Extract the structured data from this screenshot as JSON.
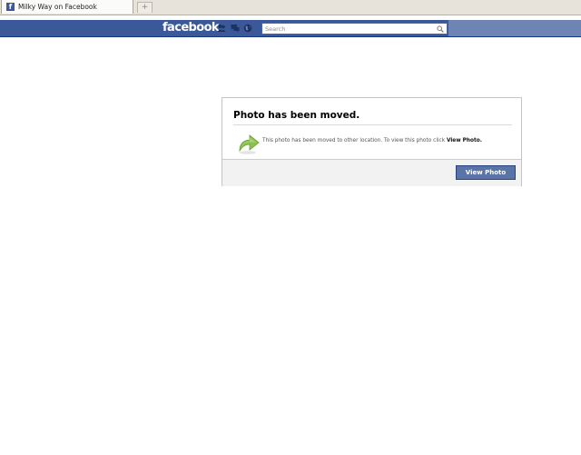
{
  "browser": {
    "tab_title": "Milky Way on Facebook",
    "tab_favicon": "f",
    "new_tab_label": "+"
  },
  "header": {
    "logo": "facebook",
    "jewel_icons": [
      "friend-requests-icon",
      "messages-icon",
      "notifications-globe-icon"
    ],
    "search": {
      "placeholder": "Search",
      "value": ""
    }
  },
  "dialog": {
    "title": "Photo has been moved.",
    "message_prefix": "This photo has been moved to other location. To view this photo click ",
    "message_link": "View Photo.",
    "button_label": "View Photo"
  },
  "colors": {
    "brand_blue": "#3b5998",
    "bar_right": "#6d84b4",
    "button_blue": "#5b74a8",
    "arrow_green": "#8cc152"
  }
}
